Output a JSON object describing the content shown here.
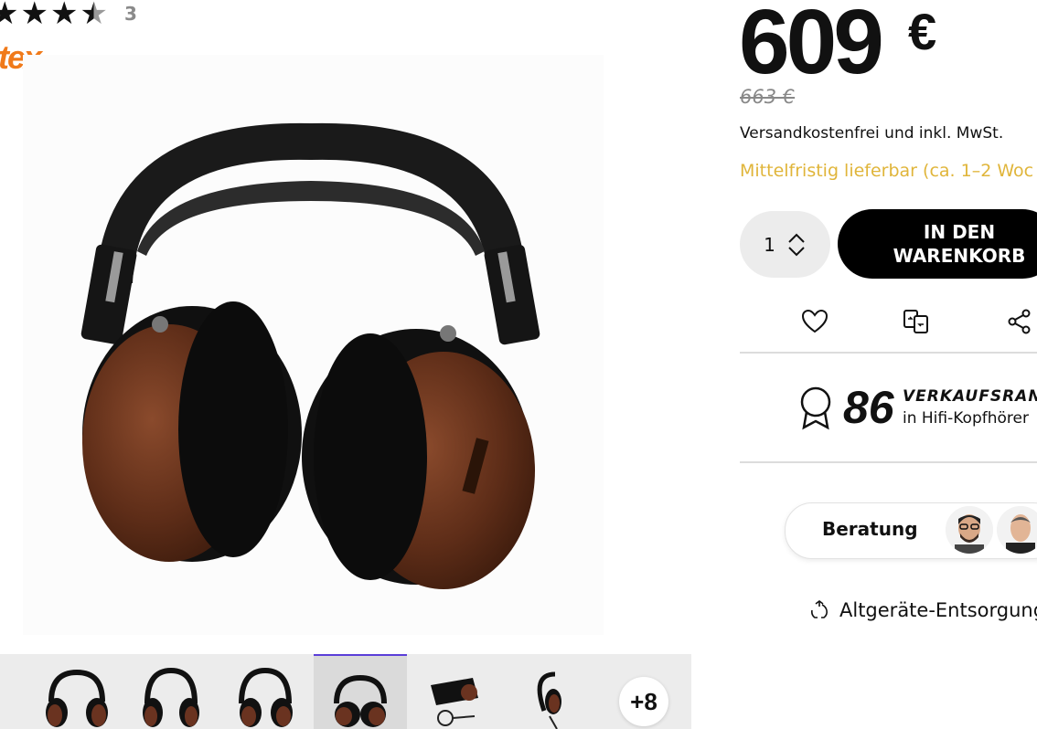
{
  "rating": {
    "stars": 3.5,
    "count": "3"
  },
  "brand": {
    "logo_text": "tex"
  },
  "product": {
    "image_alt": "Over-ear headphones with walnut wood ear cups"
  },
  "gallery": {
    "thumbnail_count": 6,
    "active_index": 3,
    "more_label": "+8"
  },
  "pricing": {
    "price": "609",
    "currency": "€",
    "old_price": "663 €",
    "shipping_note": "Versandkostenfrei und inkl. MwSt.",
    "availability": "Mittelfristig lieferbar (ca. 1–2 Woc"
  },
  "purchase": {
    "quantity": "1",
    "cart_button_label": "IN DEN WARENKORB"
  },
  "actions": {
    "icons": [
      "heart-icon",
      "compare-icon",
      "share-icon"
    ]
  },
  "ranking": {
    "number": "86",
    "label": "VERKAUFSRANG",
    "category": "in Hifi-Kopfhörer"
  },
  "advice": {
    "label": "Beratung"
  },
  "recycling": {
    "label": "Altgeräte-Entsorgung"
  },
  "colors": {
    "availability": "#e0b53a",
    "brand": "#f07a1a",
    "active_thumb_border": "#5b3fd8"
  }
}
